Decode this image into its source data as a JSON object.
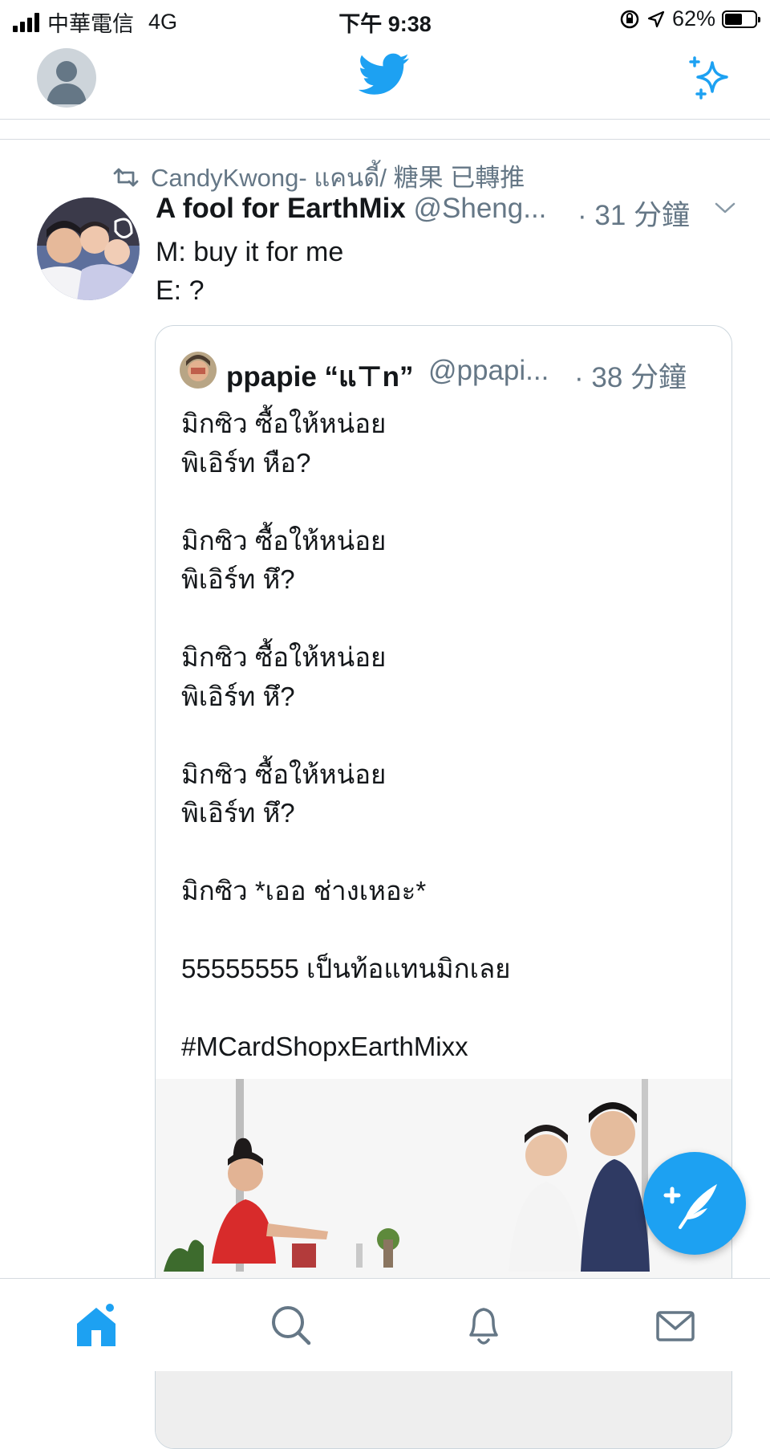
{
  "status_bar": {
    "carrier": "中華電信",
    "network": "4G",
    "time": "下午 9:38",
    "battery_percent": "62%",
    "battery_level": 0.62
  },
  "nav": {
    "avatar_icon": "default-profile-icon",
    "logo_icon": "twitter-bird-icon",
    "sparkle_icon": "sparkle-icon",
    "accent_color": "#1da1f2"
  },
  "tweet": {
    "retweet_label": "CandyKwong- แคนดี้/ 糖果 已轉推",
    "author_name": "A fool for EarthMix",
    "author_handle": "@Sheng...",
    "time": "· 31 分鐘",
    "text_lines": [
      "M: buy it for me",
      "E: ?"
    ]
  },
  "quoted": {
    "author_name": "ppapie “แ⊤n”",
    "author_handle": "@ppapi...",
    "time": "· 38 分鐘",
    "body_lines": [
      "มิกซิว ซื้อให้หน่อย",
      "พิเอิร์ท หือ?",
      "",
      "มิกซิว ซื้อให้หน่อย",
      "พิเอิร์ท หึ?",
      "",
      "มิกซิว ซื้อให้หน่อย",
      "พิเอิร์ท หึ?",
      "",
      "มิกซิว ซื้อให้หน่อย",
      "พิเอิร์ท หึ?",
      "",
      "มิกซิว *เออ ช่างเหอะ*",
      "",
      "55555555 เป็นท้อแทนมิกเลย",
      "",
      "#MCardShopxEarthMixx"
    ]
  },
  "fab": {
    "icon": "compose-tweet-icon"
  },
  "tabbar": {
    "items": [
      {
        "icon": "home-icon",
        "active": true
      },
      {
        "icon": "search-icon",
        "active": false
      },
      {
        "icon": "notifications-bell-icon",
        "active": false
      },
      {
        "icon": "messages-envelope-icon",
        "active": false
      }
    ]
  }
}
